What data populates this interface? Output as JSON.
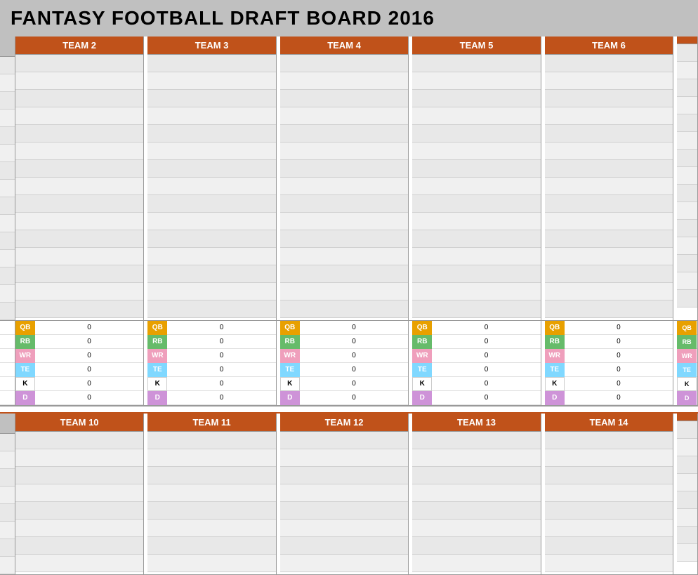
{
  "title": "FANTASY FOOTBALL DRAFT BOARD 2016",
  "teams_top": [
    "TEAM 2",
    "TEAM 3",
    "TEAM 4",
    "TEAM 5",
    "TEAM 6"
  ],
  "teams_bottom": [
    "TEAM 10",
    "TEAM 11",
    "TEAM 12",
    "TEAM 13",
    "TEAM 14"
  ],
  "num_rows": 15,
  "stat_labels": [
    "QB",
    "RB",
    "WR",
    "TE",
    "K",
    "D"
  ],
  "stat_values": [
    0,
    0,
    0,
    0,
    0,
    0
  ],
  "colors": {
    "header_bg": "#c0521a",
    "header_text": "#ffffff",
    "title_bg": "#c0c0c0",
    "qb": "#e8a000",
    "rb": "#66bb6a",
    "wr": "#ef9fbc",
    "te": "#80d8ff",
    "k": "#ffffff",
    "d": "#ce93d8"
  }
}
